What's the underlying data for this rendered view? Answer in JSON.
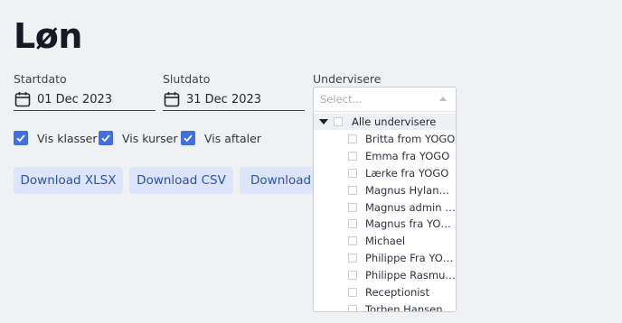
{
  "page": {
    "title": "Løn"
  },
  "filters": {
    "start_label": "Startdato",
    "start_value": "01 Dec 2023",
    "end_label": "Slutdato",
    "end_value": "31 Dec 2023",
    "teachers_label": "Undervisere"
  },
  "checkboxes": [
    {
      "label": "Vis klasser",
      "checked": true
    },
    {
      "label": "Vis kurser",
      "checked": true
    },
    {
      "label": "Vis aftaler",
      "checked": true
    }
  ],
  "buttons": {
    "xlsx": "Download XLSX",
    "csv": "Download CSV",
    "third": "Download P"
  },
  "dropdown": {
    "placeholder": "Select...",
    "root_label": "Alle undervisere",
    "items": [
      "Britta from YOGO",
      "Emma fra YOGO",
      "Lærke fra YOGO",
      "Magnus Hylander...",
      "Magnus admin F...",
      "Magnus fra YOGO",
      "Michael",
      "Philippe Fra YOGO",
      "Philippe Rasmus...",
      "Receptionist",
      "Torben Hansen"
    ]
  },
  "colors": {
    "accent": "#3f6fe0",
    "button_bg": "#dce5f9",
    "button_text": "#2952b8",
    "background": "#f0f1f3"
  }
}
